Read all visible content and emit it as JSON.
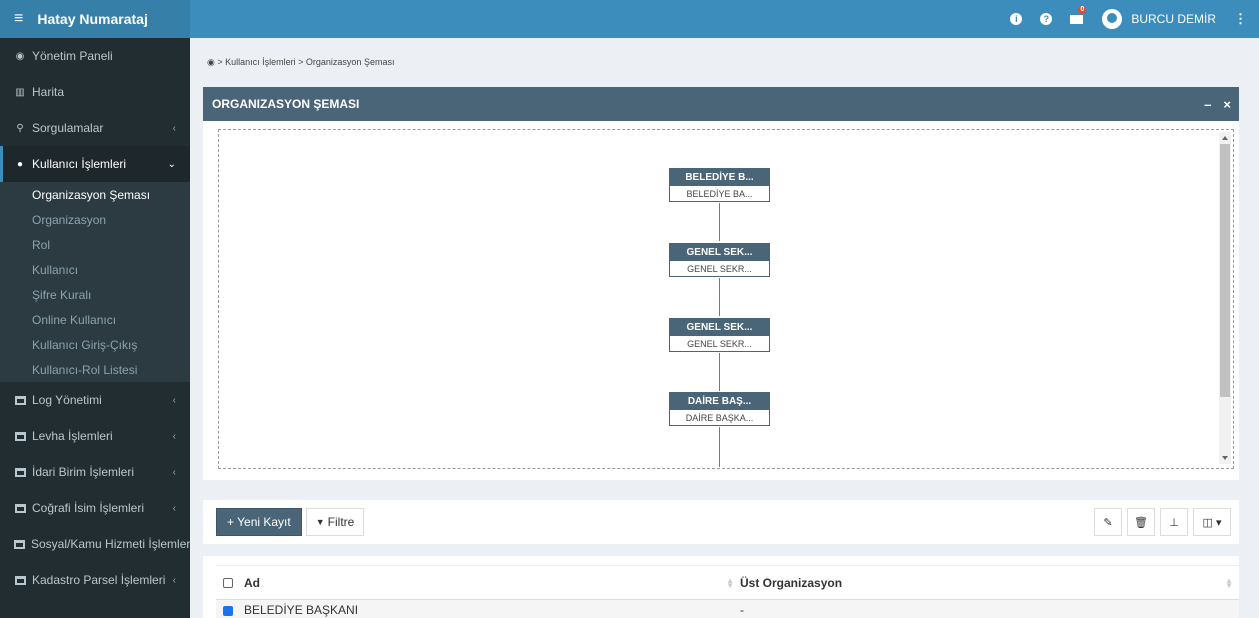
{
  "app": {
    "title": "Hatay Numarataj",
    "menu_icon": "hamburger-icon"
  },
  "topbar": {
    "info_icon": "info-icon",
    "help_icon": "question-icon",
    "mail_icon": "envelope-icon",
    "mail_badge": "0",
    "user_name": "BURCU DEMİR",
    "more_icon": "vertical-ellipsis-icon"
  },
  "sidebar": {
    "items": [
      {
        "label": "Yönetim Paneli",
        "icon": "dashboard-icon"
      },
      {
        "label": "Harita",
        "icon": "map-icon"
      },
      {
        "label": "Sorgulamalar",
        "icon": "search-icon"
      },
      {
        "label": "Kullanıcı İşlemleri",
        "icon": "users-icon"
      },
      {
        "label": "Log Yönetimi",
        "icon": "window-icon"
      },
      {
        "label": "Levha İşlemleri",
        "icon": "window-icon"
      },
      {
        "label": "İdari Birim İşlemleri",
        "icon": "window-icon"
      },
      {
        "label": "Coğrafi İsim İşlemleri",
        "icon": "window-icon"
      },
      {
        "label": "Sosyal/Kamu Hizmeti İşlemleri",
        "icon": "window-icon"
      },
      {
        "label": "Kadastro Parsel İşlemleri",
        "icon": "window-icon"
      }
    ],
    "submenu": [
      "Organizasyon Şeması",
      "Organizasyon",
      "Rol",
      "Kullanıcı",
      "Şifre Kuralı",
      "Online Kullanıcı",
      "Kullanıcı Giriş-Çıkış",
      "Kullanıcı-Rol Listesi"
    ]
  },
  "breadcrumb": "> Kullanıcı İşlemleri > Organizasyon Şeması",
  "org_panel": {
    "title": "ORGANIZASYON ŞEMASI",
    "minimize": "–",
    "close": "×",
    "nodes": [
      {
        "title": "BELEDİYE B...",
        "subtitle": "BELEDİYE BA..."
      },
      {
        "title": "GENEL SEK...",
        "subtitle": "GENEL SEKR..."
      },
      {
        "title": "GENEL SEK...",
        "subtitle": "GENEL SEKR..."
      },
      {
        "title": "DAİRE BAŞ...",
        "subtitle": "DAİRE BAŞKA..."
      }
    ]
  },
  "toolbar": {
    "new_label": "+ Yeni Kayıt",
    "filter_label": "Filtre",
    "edit_icon": "pencil-icon",
    "delete_icon": "trash-icon",
    "tree_icon": "sitemap-icon",
    "columns_icon": "columns-icon"
  },
  "table": {
    "columns": [
      "Ad",
      "Üst Organizasyon"
    ],
    "rows": [
      {
        "checked": true,
        "ad": "BELEDİYE BAŞKANI",
        "ust": "-"
      }
    ]
  },
  "colors": {
    "header": "#3c8dbc",
    "sidebar": "#222d32",
    "panel_header": "#4a6577",
    "connector": "#e74c3c"
  }
}
